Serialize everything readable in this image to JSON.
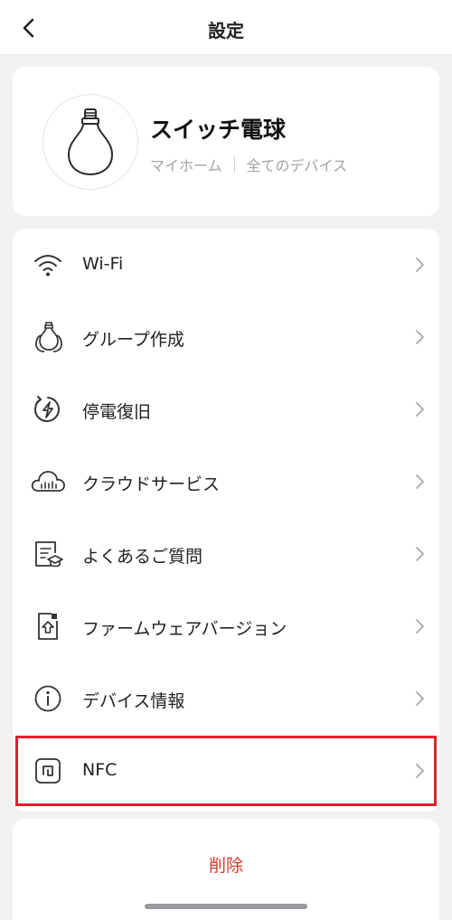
{
  "header": {
    "title": "設定",
    "back_icon": "chevron-left-icon"
  },
  "device": {
    "name": "スイッチ電球",
    "home": "マイホーム",
    "group": "全てのデバイス",
    "icon": "light-bulb-icon"
  },
  "menu": {
    "items": [
      {
        "label": "Wi-Fi",
        "icon": "wifi-icon"
      },
      {
        "label": "グループ作成",
        "icon": "bulb-group-icon"
      },
      {
        "label": "停電復旧",
        "icon": "power-restore-icon"
      },
      {
        "label": "クラウドサービス",
        "icon": "cloud-icon"
      },
      {
        "label": "よくあるご質問",
        "icon": "faq-icon"
      },
      {
        "label": "ファームウェアバージョン",
        "icon": "firmware-upload-icon"
      },
      {
        "label": "デバイス情報",
        "icon": "info-icon"
      },
      {
        "label": "NFC",
        "icon": "nfc-icon"
      }
    ],
    "highlighted_item": "NFC",
    "highlight_color": "#e0202b"
  },
  "delete": {
    "label": "削除",
    "color": "#d23a2f"
  }
}
